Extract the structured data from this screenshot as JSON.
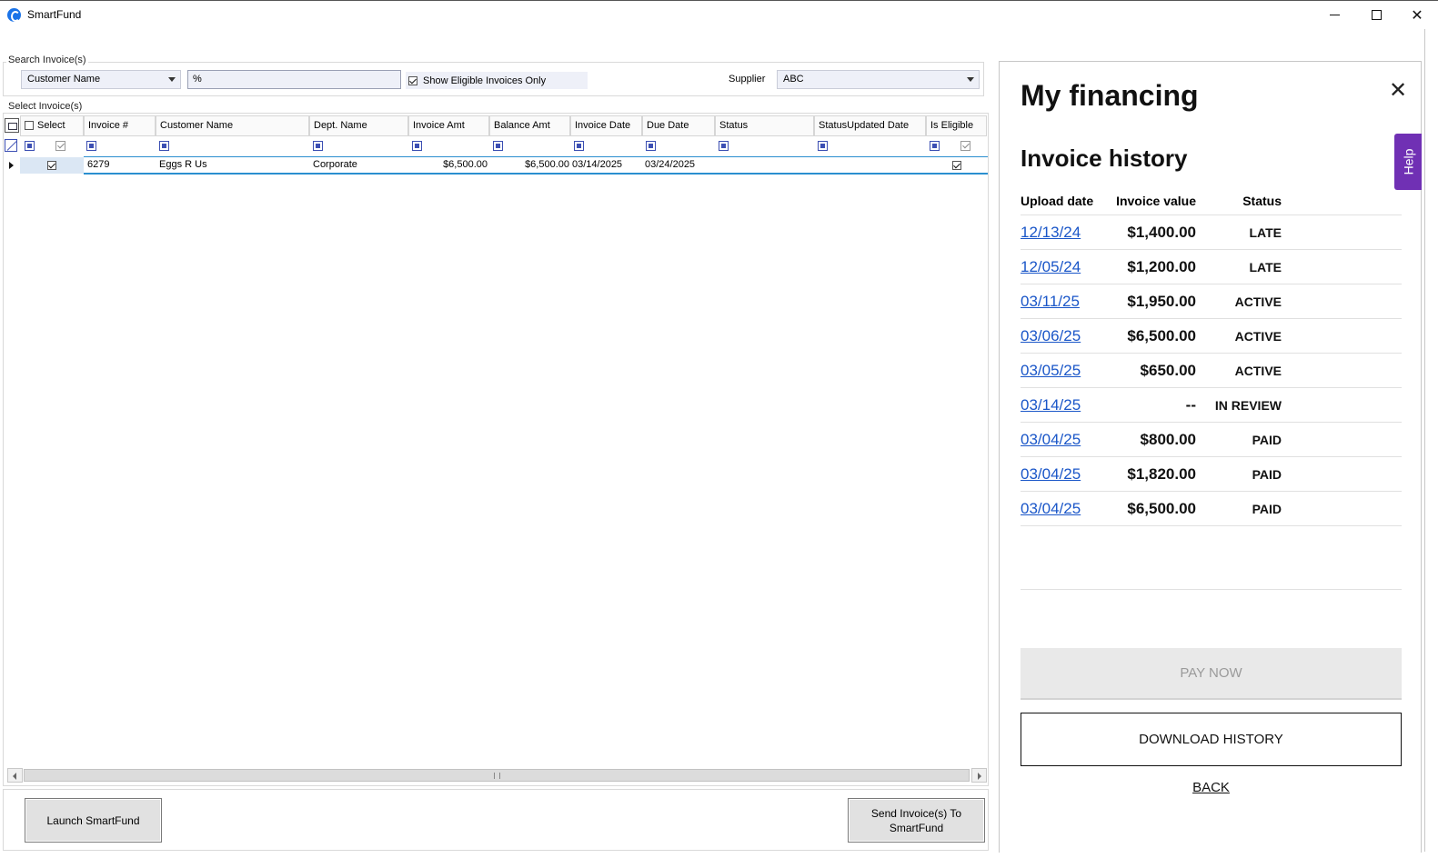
{
  "window": {
    "title": "SmartFund",
    "minimize_icon": "minimize-icon",
    "maximize_icon": "maximize-icon",
    "close_icon": "close-icon"
  },
  "search": {
    "group_label": "Search Invoice(s)",
    "field_select": "Customer Name",
    "search_value": "%",
    "eligible_only_label": "Show Eligible Invoices Only",
    "eligible_only_checked": true,
    "supplier_label": "Supplier",
    "supplier_value": "ABC"
  },
  "grid": {
    "group_label": "Select Invoice(s)",
    "columns": [
      "Select",
      "Invoice #",
      "Customer Name",
      "Dept. Name",
      "Invoice Amt",
      "Balance Amt",
      "Invoice Date",
      "Due Date",
      "Status",
      "StatusUpdated Date",
      "Is Eligible"
    ],
    "rows": [
      {
        "selected": true,
        "invoice_no": "6279",
        "customer_name": "Eggs R Us",
        "dept_name": "Corporate",
        "invoice_amt": "$6,500.00",
        "balance_amt": "$6,500.00",
        "invoice_date": "03/14/2025",
        "due_date": "03/24/2025",
        "status": "",
        "status_updated_date": "",
        "is_eligible": true
      }
    ]
  },
  "buttons": {
    "launch": "Launch SmartFund",
    "send": "Send Invoice(s) To SmartFund"
  },
  "panel": {
    "title": "My financing",
    "help_label": "Help",
    "section_title": "Invoice history",
    "headers": {
      "upload_date": "Upload date",
      "invoice_value": "Invoice value",
      "status": "Status"
    },
    "history": [
      {
        "date": "12/13/24",
        "value": "$1,400.00",
        "status": "LATE"
      },
      {
        "date": "12/05/24",
        "value": "$1,200.00",
        "status": "LATE"
      },
      {
        "date": "03/11/25",
        "value": "$1,950.00",
        "status": "ACTIVE"
      },
      {
        "date": "03/06/25",
        "value": "$6,500.00",
        "status": "ACTIVE"
      },
      {
        "date": "03/05/25",
        "value": "$650.00",
        "status": "ACTIVE"
      },
      {
        "date": "03/14/25",
        "value": "--",
        "status": "IN REVIEW"
      },
      {
        "date": "03/04/25",
        "value": "$800.00",
        "status": "PAID"
      },
      {
        "date": "03/04/25",
        "value": "$1,820.00",
        "status": "PAID"
      },
      {
        "date": "03/04/25",
        "value": "$6,500.00",
        "status": "PAID"
      }
    ],
    "pay_now": "PAY NOW",
    "download_history": "DOWNLOAD HISTORY",
    "back": "BACK",
    "link_color": "#1a56c8",
    "help_color": "#7030b4"
  }
}
